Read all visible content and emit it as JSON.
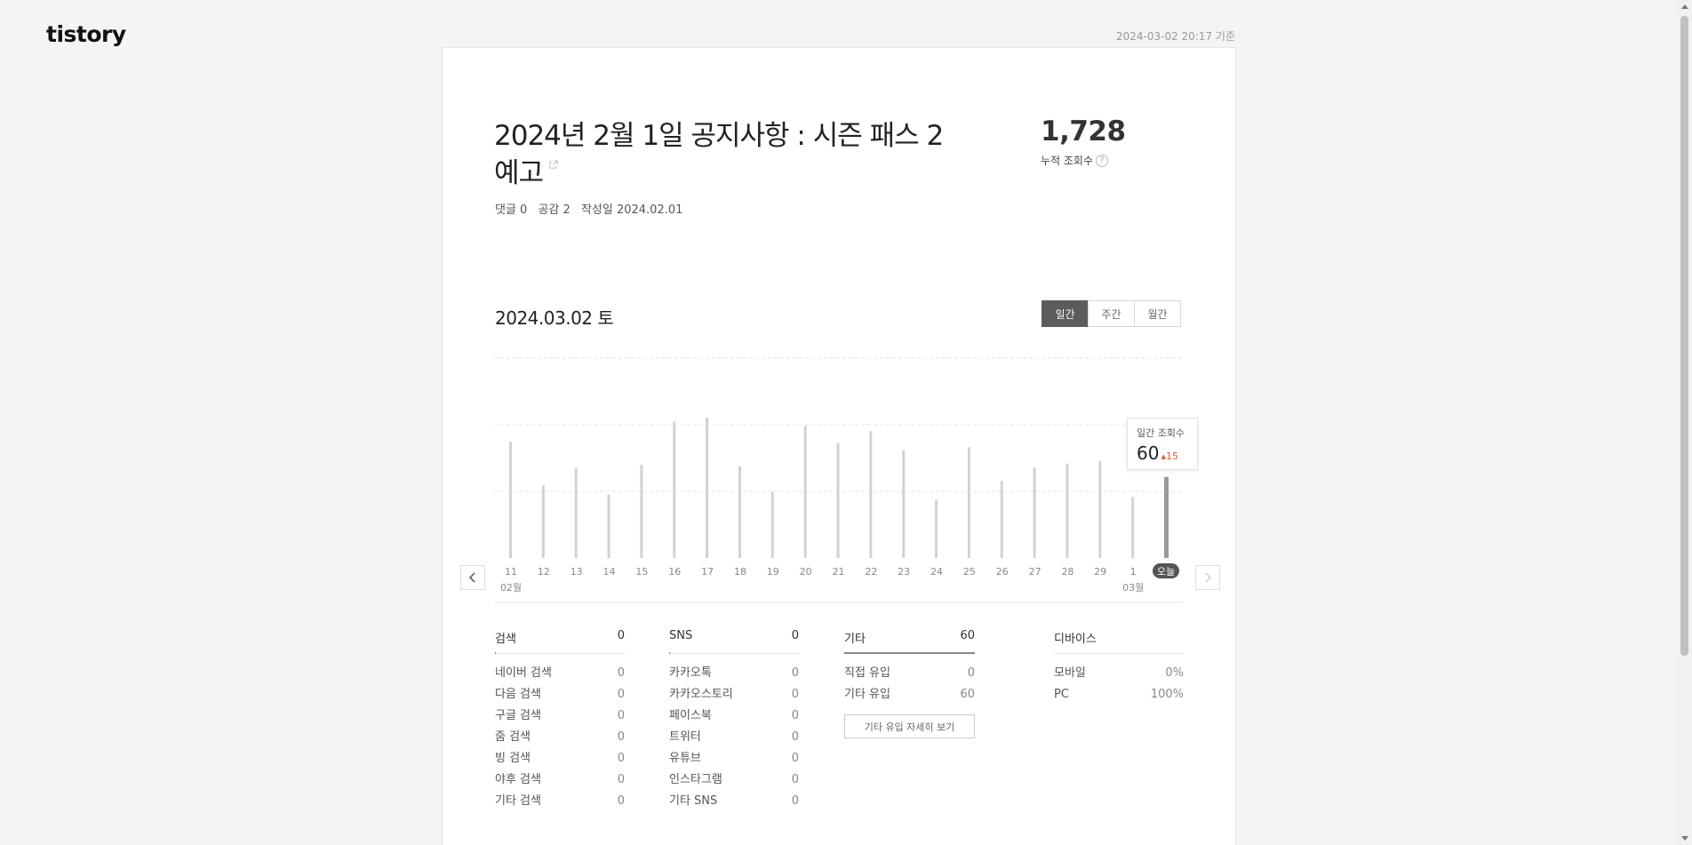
{
  "logo": "tistory",
  "timestamp": "2024-03-02 20:17 기준",
  "post": {
    "title": "2024년 2월 1일 공지사항 : 시즌 패스 2 예고",
    "comments": "댓글 0",
    "likes": "공감 2",
    "date": "작성일 2024.02.01"
  },
  "views": {
    "total": "1,728",
    "label": "누적 조회수",
    "help": "?"
  },
  "chart_header": {
    "date": "2024.03.02 토"
  },
  "tabs": [
    {
      "label": "일간",
      "active": true
    },
    {
      "label": "주간",
      "active": false
    },
    {
      "label": "월간",
      "active": false
    }
  ],
  "chart_data": {
    "type": "bar",
    "categories": [
      "11",
      "12",
      "13",
      "14",
      "15",
      "16",
      "17",
      "18",
      "19",
      "20",
      "21",
      "22",
      "23",
      "24",
      "25",
      "26",
      "27",
      "28",
      "29",
      "1",
      "오늘"
    ],
    "month_labels": [
      {
        "index": 0,
        "label": "02월"
      },
      {
        "index": 19,
        "label": "03월"
      }
    ],
    "values": [
      86,
      54,
      67,
      47,
      69,
      101,
      104,
      68,
      49,
      98,
      85,
      94,
      80,
      43,
      82,
      57,
      67,
      70,
      72,
      45,
      60
    ],
    "highlight_index": 20,
    "ylim": [
      0,
      150
    ]
  },
  "tooltip": {
    "label": "일간 조회수",
    "value": "60",
    "delta": "15"
  },
  "stats": {
    "search": {
      "title": "검색",
      "total": "0",
      "rows": [
        {
          "label": "네이버 검색",
          "value": "0"
        },
        {
          "label": "다음 검색",
          "value": "0"
        },
        {
          "label": "구글 검색",
          "value": "0"
        },
        {
          "label": "줌 검색",
          "value": "0"
        },
        {
          "label": "빙 검색",
          "value": "0"
        },
        {
          "label": "야후 검색",
          "value": "0"
        },
        {
          "label": "기타 검색",
          "value": "0"
        }
      ]
    },
    "sns": {
      "title": "SNS",
      "total": "0",
      "rows": [
        {
          "label": "카카오톡",
          "value": "0"
        },
        {
          "label": "카카오스토리",
          "value": "0"
        },
        {
          "label": "페이스북",
          "value": "0"
        },
        {
          "label": "트위터",
          "value": "0"
        },
        {
          "label": "유튜브",
          "value": "0"
        },
        {
          "label": "인스타그램",
          "value": "0"
        },
        {
          "label": "기타 SNS",
          "value": "0"
        }
      ]
    },
    "etc": {
      "title": "기타",
      "total": "60",
      "rows": [
        {
          "label": "직접 유입",
          "value": "0"
        },
        {
          "label": "기타 유입",
          "value": "60"
        }
      ],
      "detail_button": "기타 유입 자세히 보기"
    },
    "device": {
      "title": "디바이스",
      "rows": [
        {
          "label": "모바일",
          "value": "0%"
        },
        {
          "label": "PC",
          "value": "100%"
        }
      ]
    }
  }
}
